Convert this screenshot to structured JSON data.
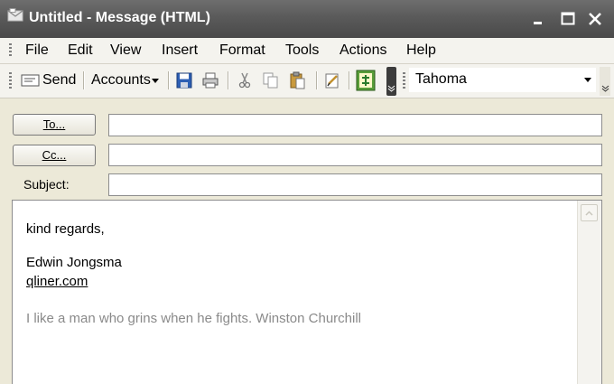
{
  "window": {
    "title": "Untitled - Message (HTML)"
  },
  "menu": [
    "File",
    "Edit",
    "View",
    "Insert",
    "Format",
    "Tools",
    "Actions",
    "Help"
  ],
  "toolbar": {
    "send_label": "Send",
    "accounts_label": "Accounts",
    "font_name": "Tahoma",
    "icons": [
      "send-icon",
      "accounts-dropdown-icon",
      "save-icon",
      "print-icon",
      "cut-icon",
      "copy-icon",
      "paste-icon",
      "signature-icon",
      "permission-icon"
    ]
  },
  "header": {
    "to_label": "To...",
    "cc_label": "Cc...",
    "subject_label": "Subject:",
    "to_value": "",
    "cc_value": "",
    "subject_value": ""
  },
  "body": {
    "closing": "kind regards,",
    "name": "Edwin Jongsma",
    "link": "qliner.com",
    "quote": "I like a man who grins when he fights. Winston Churchill"
  },
  "colors": {
    "titlebar": "#5a5a5a",
    "chrome": "#ece9d8",
    "quote_text": "#8a8a8a"
  }
}
